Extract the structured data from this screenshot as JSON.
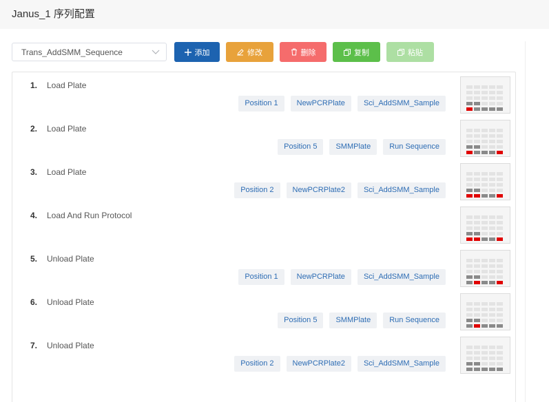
{
  "page": {
    "title": "Janus_1 序列配置"
  },
  "sequence_select": {
    "value": "Trans_AddSMM_Sequence"
  },
  "toolbar": {
    "add_label": "添加",
    "edit_label": "修改",
    "delete_label": "删除",
    "copy_label": "复制",
    "paste_label": "粘贴"
  },
  "colors": {
    "add": "#1d63b0",
    "edit": "#e8a23b",
    "delete": "#f56c6c",
    "copy": "#5cbf4a",
    "paste_disabled": "#addfa3",
    "well_empty": "#e3e3e3",
    "well_filled": "#8a8a8a",
    "well_active": "#e00000"
  },
  "steps": [
    {
      "num": "1.",
      "name": "Load Plate",
      "tags": [
        "Position 1",
        "NewPCRPlate",
        "Sci_AddSMM_Sample"
      ],
      "active_wells": [
        0
      ]
    },
    {
      "num": "2.",
      "name": "Load Plate",
      "tags": [
        "Position 5",
        "SMMPlate",
        "Run Sequence"
      ],
      "active_wells": [
        0,
        4
      ]
    },
    {
      "num": "3.",
      "name": "Load Plate",
      "tags": [
        "Position 2",
        "NewPCRPlate2",
        "Sci_AddSMM_Sample"
      ],
      "active_wells": [
        0,
        1,
        4
      ]
    },
    {
      "num": "4.",
      "name": "Load And Run Protocol",
      "tags": [],
      "active_wells": [
        0,
        1,
        4
      ]
    },
    {
      "num": "5.",
      "name": "Unload Plate",
      "tags": [
        "Position 1",
        "NewPCRPlate",
        "Sci_AddSMM_Sample"
      ],
      "active_wells": [
        1,
        4
      ]
    },
    {
      "num": "6.",
      "name": "Unload Plate",
      "tags": [
        "Position 5",
        "SMMPlate",
        "Run Sequence"
      ],
      "active_wells": [
        1
      ]
    },
    {
      "num": "7.",
      "name": "Unload Plate",
      "tags": [
        "Position 2",
        "NewPCRPlate2",
        "Sci_AddSMM_Sample"
      ],
      "active_wells": []
    }
  ]
}
